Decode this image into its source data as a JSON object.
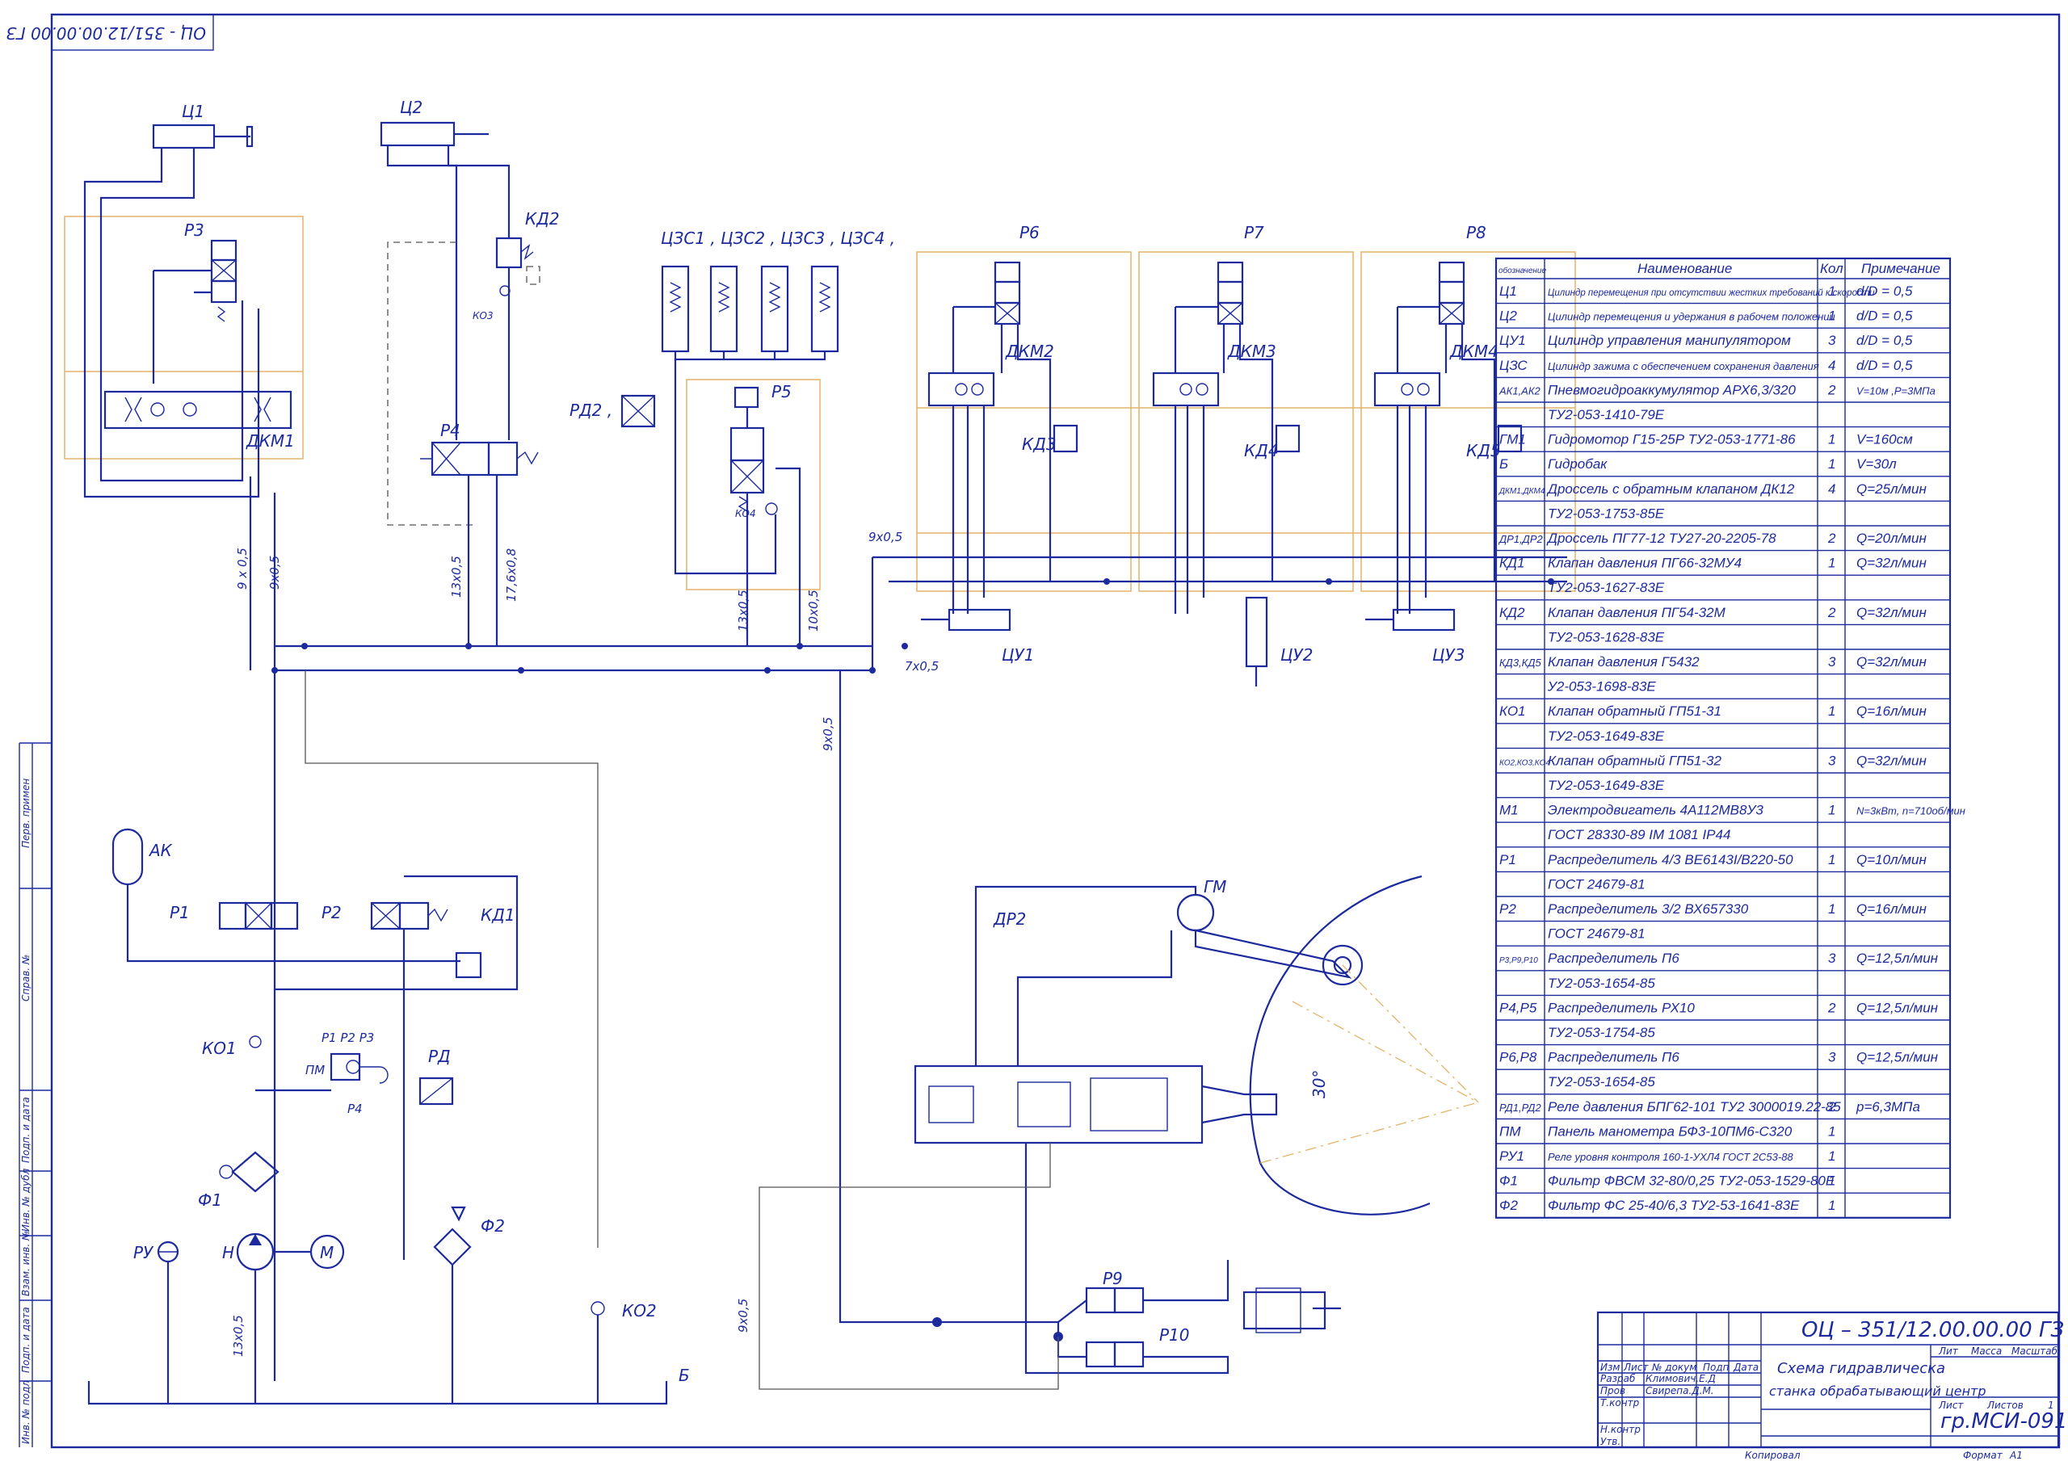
{
  "drawing": {
    "top_stamp": "ОЦ - 351/12.00.00.00 ГЗ",
    "title_block": {
      "designation": "ОЦ – 351/12.00.00.00 ГЗ",
      "title_line1": "Схема гидравлическа",
      "title_line2": "станка обрабатывающий центр",
      "group": "гр.МСИ-091",
      "lit": "Лит",
      "mass": "Масса",
      "scale": "Масштаб",
      "sheet": "Лист",
      "sheets": "Листов",
      "sheets_count": "1",
      "izm": "Изм",
      "list": "Лист",
      "doc_no": "№ докум",
      "sign": "Подп",
      "date": "Дата",
      "razrab": "Разраб",
      "razrab_name": "Климович.Е.Д",
      "prov": "Пров",
      "prov_name": "Свирепа.Д.М.",
      "tkontr": "Т.контр",
      "nkontr": "Н.контр",
      "utv": "Утв.",
      "copied": "Копировал",
      "format": "Формат",
      "format_val": "А1"
    },
    "side_labels": [
      "Перв. примен",
      "Справ. №",
      "Подп. и дата",
      "Инв. № дубл",
      "Взам. инв. №",
      "Подп. и дата",
      "Инв. № подл"
    ]
  },
  "components": {
    "c1": "Ц1",
    "c2": "Ц2",
    "p3": "Р3",
    "dkm1": "ДКМ1",
    "kd2": "КД2",
    "ko3": "КО3",
    "p4": "Р4",
    "czs": "ЦЗС1 , ЦЗС2 , ЦЗС3 , ЦЗС4 ,",
    "rd2": "РД2 ,",
    "p5": "Р5",
    "ko4": "КО4",
    "p6": "Р6",
    "p7": "Р7",
    "p8": "Р8",
    "dkm2": "ДКМ2",
    "dkm3": "ДКМ3",
    "dkm4": "ДКМ4",
    "kd3": "КД3",
    "kd4": "КД4",
    "kd5": "КД5",
    "cu1": "ЦУ1",
    "cu2": "ЦУ2",
    "cu3": "ЦУ3",
    "ak": "АК",
    "p1": "Р1",
    "p2": "Р2",
    "kd1": "КД1",
    "ko1": "КО1",
    "pm": "ПМ",
    "pm_ports": "Р1 Р2 Р3",
    "p4b": "Р4",
    "rd": "РД",
    "f1": "Ф1",
    "f2": "Ф2",
    "h": "Н",
    "m": "М",
    "ru": "РУ",
    "ko2": "КО2",
    "b": "Б",
    "gm": "ГМ",
    "dr2": "ДР2",
    "p9": "Р9",
    "p10": "Р10",
    "angle": "30°"
  },
  "pipes": {
    "p1": "9 x 0,5",
    "p2": "9x0,5",
    "p3": "13x0,5",
    "p4": "17,6x0,8",
    "p5": "13x0,5",
    "p6": "10x0,5",
    "p7": "9x0,5",
    "p8": "7x0,5",
    "p9": "9x0,5",
    "p10": "9x0,5",
    "p11": "13x0,5"
  },
  "table": {
    "headers": [
      "обозначение",
      "Наименование",
      "Кол",
      "Примечание"
    ],
    "rows": [
      [
        "Ц1",
        "Цилиндр перемещения при отсутствии жестких требований к скорости",
        "1",
        "d/D = 0,5"
      ],
      [
        "Ц2",
        "Цилиндр перемещения и удержания в рабочем положении",
        "1",
        "d/D = 0,5"
      ],
      [
        "ЦУ1",
        "Цилиндр управления манипулятором",
        "3",
        "d/D = 0,5"
      ],
      [
        "ЦЗС",
        "Цилиндр зажима с обеспечением сохранения давления",
        "4",
        "d/D = 0,5"
      ],
      [
        "АК1,АК2",
        "Пневмогидроаккумулятор АРХ6,3/320",
        "2",
        "V=10м ,P=3МПа"
      ],
      [
        "",
        "ТУ2-053-1410-79Е",
        "",
        ""
      ],
      [
        "ГМ1",
        "Гидромотор Г15-25Р ТУ2-053-1771-86",
        "1",
        "V=160см"
      ],
      [
        "Б",
        "Гидробак",
        "1",
        "V=30л"
      ],
      [
        "ДКМ1,ДКМ4",
        "Дроссель с обратным клапаном ДК12",
        "4",
        "Q=25л/мин"
      ],
      [
        "",
        "ТУ2-053-1753-85Е",
        "",
        ""
      ],
      [
        "ДР1,ДР2",
        "Дроссель ПГ77-12  ТУ27-20-2205-78",
        "2",
        "Q=20л/мин"
      ],
      [
        "КД1",
        "Клапан давления ПГ66-32МУ4",
        "1",
        "Q=32л/мин"
      ],
      [
        "",
        "ТУ2-053-1627-83Е",
        "",
        ""
      ],
      [
        "КД2",
        "Клапан давления ПГ54-32М",
        "2",
        "Q=32л/мин"
      ],
      [
        "",
        "ТУ2-053-1628-83Е",
        "",
        ""
      ],
      [
        "КД3,КД5",
        "Клапан давления Г5432",
        "3",
        "Q=32л/мин"
      ],
      [
        "",
        "У2-053-1698-83Е",
        "",
        ""
      ],
      [
        "КО1",
        "Клапан обратный ГП51-31",
        "1",
        "Q=16л/мин"
      ],
      [
        "",
        "ТУ2-053-1649-83Е",
        "",
        ""
      ],
      [
        "КО2,КО3,КО4",
        "Клапан обратный ГП51-32",
        "3",
        "Q=32л/мин"
      ],
      [
        "",
        "ТУ2-053-1649-83Е",
        "",
        ""
      ],
      [
        "М1",
        "Электродвигатель 4А112МВ8У3",
        "1",
        "N=3кВт, n=710об/мин"
      ],
      [
        "",
        "ГОСТ 28330-89 IM 1081 IP44",
        "",
        ""
      ],
      [
        "Р1",
        "Распределитель 4/3  ВЕ6143I/В220-50",
        "1",
        "Q=10л/мин"
      ],
      [
        "",
        "ГОСТ 24679-81",
        "",
        ""
      ],
      [
        "Р2",
        "Распределитель 3/2  ВХ657330",
        "1",
        "Q=16л/мин"
      ],
      [
        "",
        "ГОСТ 24679-81",
        "",
        ""
      ],
      [
        "Р3,Р9,Р10",
        "Распределитель П6",
        "3",
        "Q=12,5л/мин"
      ],
      [
        "",
        "ТУ2-053-1654-85",
        "",
        ""
      ],
      [
        "Р4,Р5",
        "Распределитель РХ10",
        "2",
        "Q=12,5л/мин"
      ],
      [
        "",
        "ТУ2-053-1754-85",
        "",
        ""
      ],
      [
        "Р6,Р8",
        "Распределитель П6",
        "3",
        "Q=12,5л/мин"
      ],
      [
        "",
        "ТУ2-053-1654-85",
        "",
        ""
      ],
      [
        "РД1,РД2",
        "Реле давления БПГ62-101 ТУ2 3000019.22-85",
        "2",
        "p=6,3МПа"
      ],
      [
        "ПМ",
        "Панель манометра БФ3-10ПМ6-С320",
        "1",
        ""
      ],
      [
        "РУ1",
        "Реле уровня контроля 160-1-УХЛ4 ГОСТ 2С53-88",
        "1",
        ""
      ],
      [
        "Ф1",
        "Фильтр ФВСМ 32-80/0,25 ТУ2-053-1529-80Е",
        "1",
        ""
      ],
      [
        "Ф2",
        "Фильтр ФС 25-40/6,3 ТУ2-53-1641-83Е",
        "1",
        ""
      ]
    ]
  }
}
